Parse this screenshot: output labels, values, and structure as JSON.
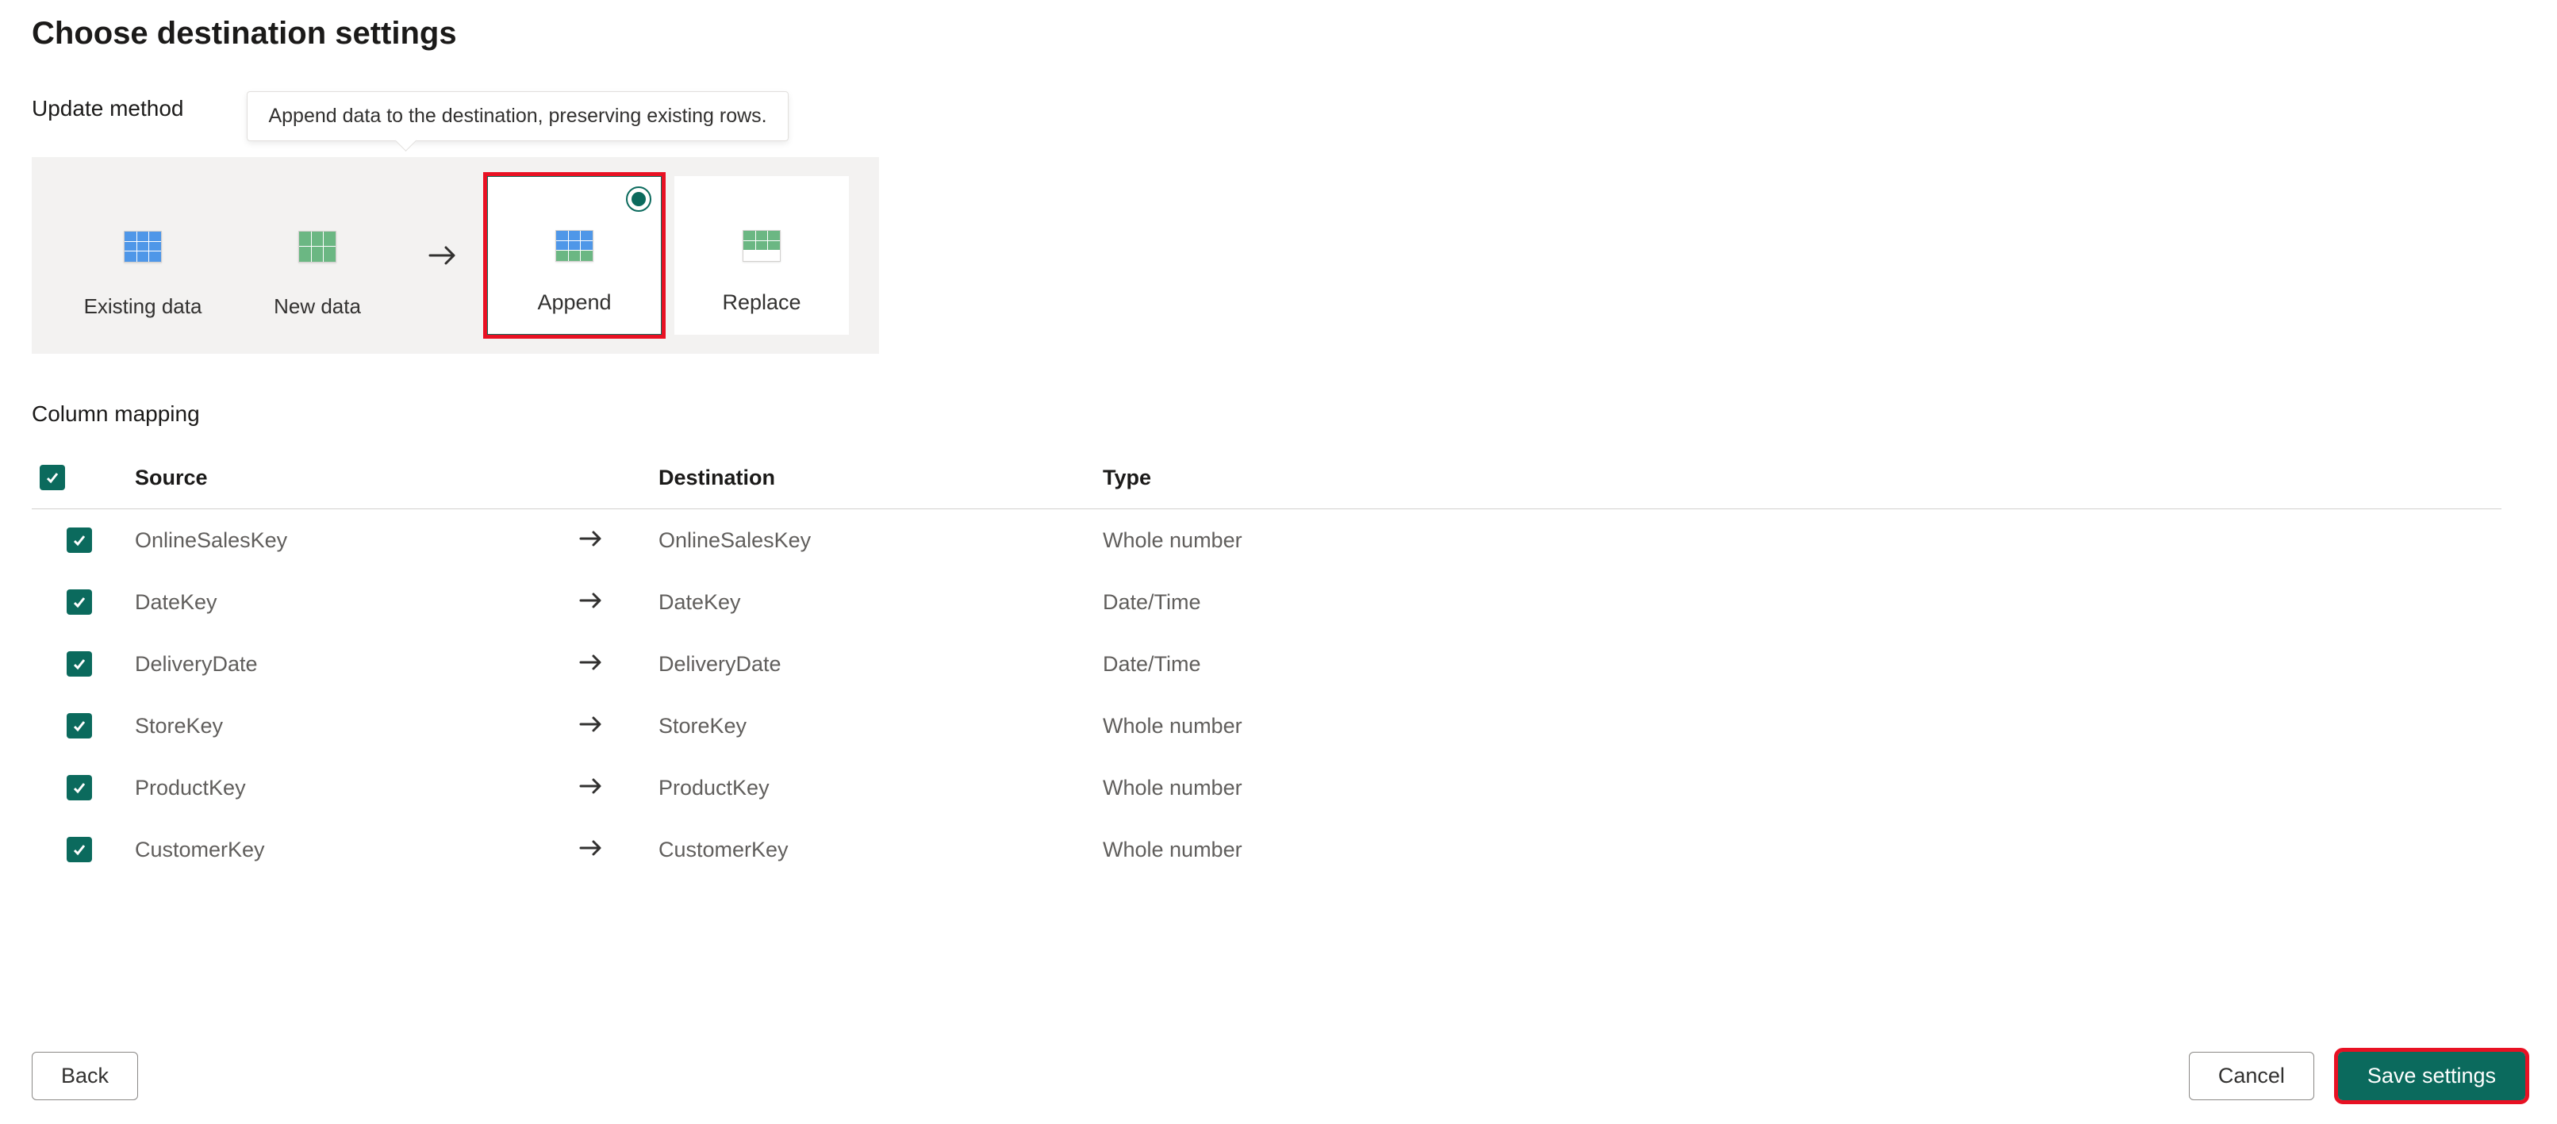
{
  "title": "Choose destination settings",
  "updateMethod": {
    "label": "Update method",
    "tooltip": "Append data to the destination, preserving existing rows.",
    "existing": "Existing data",
    "newData": "New data",
    "append": "Append",
    "replace": "Replace"
  },
  "columnMapping": {
    "label": "Column mapping",
    "headers": {
      "source": "Source",
      "destination": "Destination",
      "type": "Type"
    },
    "rows": [
      {
        "source": "OnlineSalesKey",
        "destination": "OnlineSalesKey",
        "type": "Whole number"
      },
      {
        "source": "DateKey",
        "destination": "DateKey",
        "type": "Date/Time"
      },
      {
        "source": "DeliveryDate",
        "destination": "DeliveryDate",
        "type": "Date/Time"
      },
      {
        "source": "StoreKey",
        "destination": "StoreKey",
        "type": "Whole number"
      },
      {
        "source": "ProductKey",
        "destination": "ProductKey",
        "type": "Whole number"
      },
      {
        "source": "CustomerKey",
        "destination": "CustomerKey",
        "type": "Whole number"
      }
    ]
  },
  "buttons": {
    "back": "Back",
    "cancel": "Cancel",
    "save": "Save settings"
  }
}
